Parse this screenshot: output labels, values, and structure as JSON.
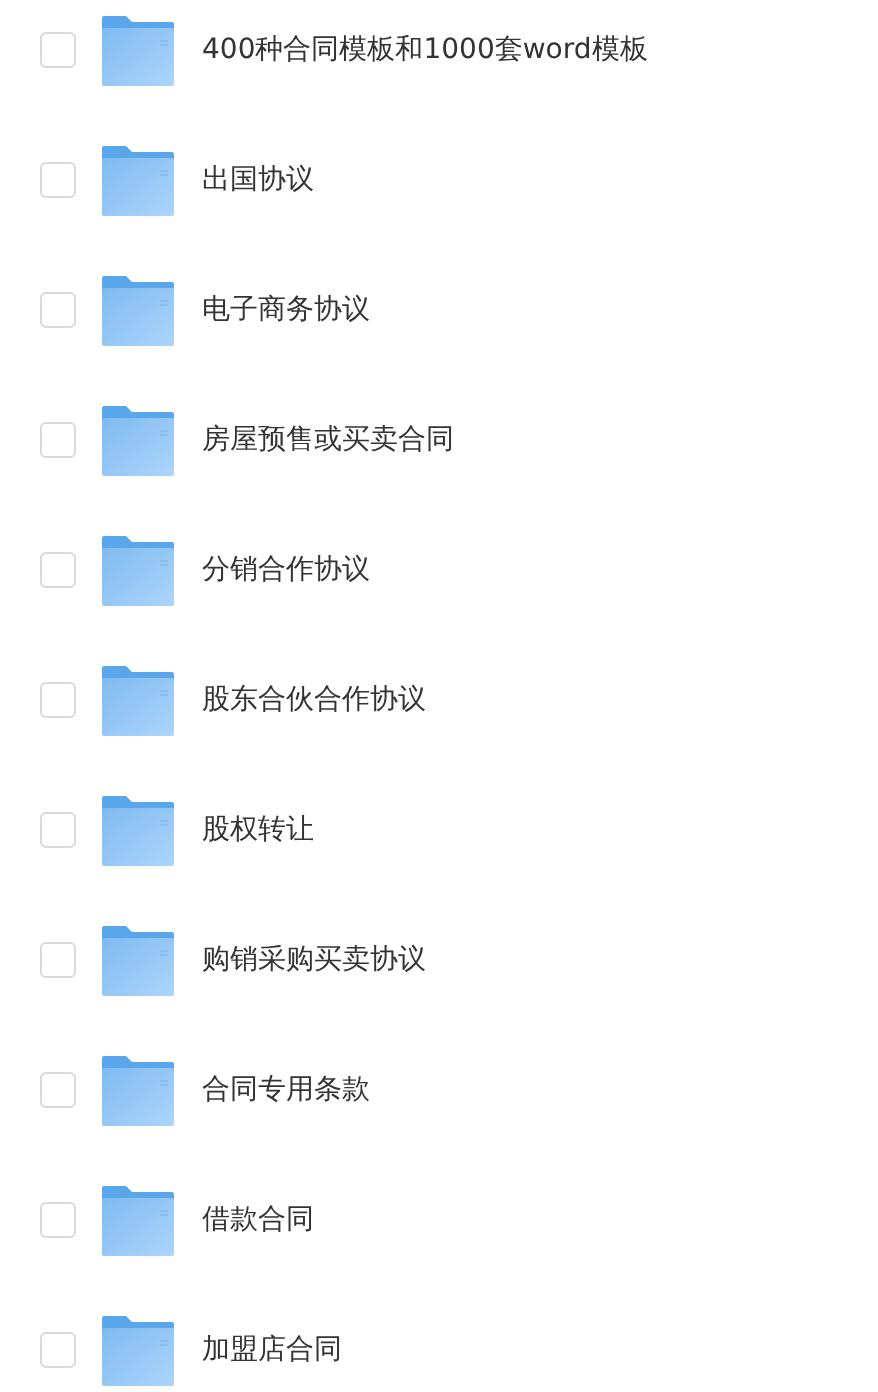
{
  "files": [
    {
      "name": "400种合同模板和1000套word模板",
      "checked": false
    },
    {
      "name": "出国协议",
      "checked": false
    },
    {
      "name": "电子商务协议",
      "checked": false
    },
    {
      "name": "房屋预售或买卖合同",
      "checked": false
    },
    {
      "name": "分销合作协议",
      "checked": false
    },
    {
      "name": "股东合伙合作协议",
      "checked": false
    },
    {
      "name": "股权转让",
      "checked": false
    },
    {
      "name": "购销采购买卖协议",
      "checked": false
    },
    {
      "name": "合同专用条款",
      "checked": false
    },
    {
      "name": "借款合同",
      "checked": false
    },
    {
      "name": "加盟店合同",
      "checked": false
    }
  ]
}
